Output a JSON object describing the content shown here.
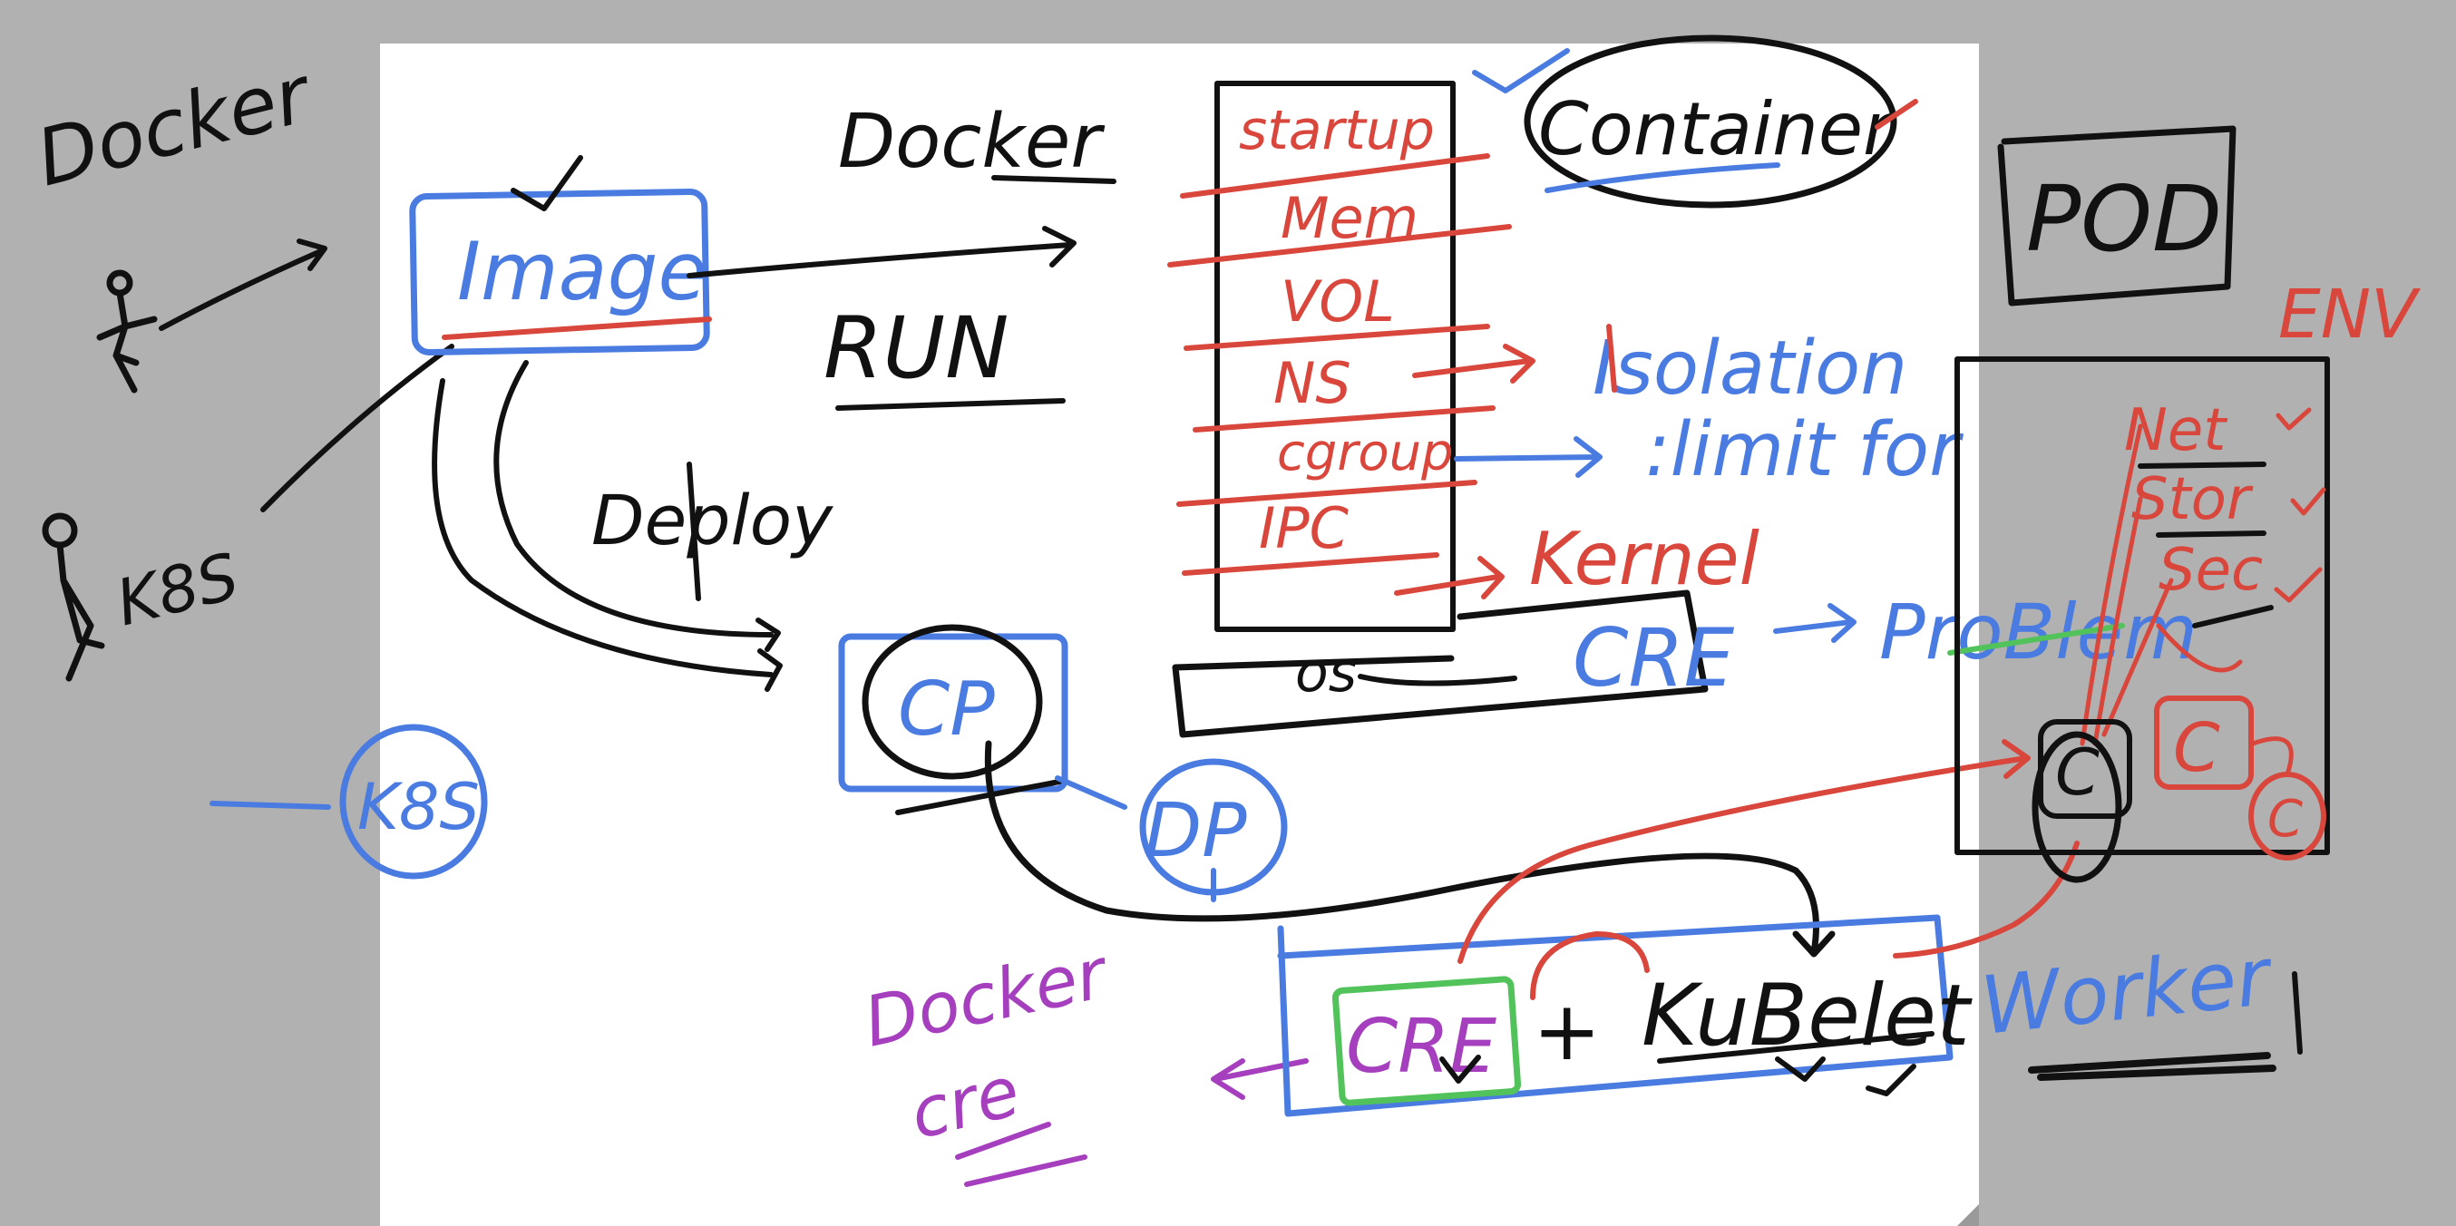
{
  "colors": {
    "background": "#b1b1b1",
    "board": "#ffffff",
    "ink_black": "#111111",
    "ink_blue": "#4a7be0",
    "ink_red": "#d8463c",
    "ink_purple": "#a53fbe",
    "ink_green": "#52c25a"
  },
  "labels": {
    "docker_top_left": "Docker",
    "k8s_actor": "K8S",
    "image": "Image",
    "docker_title": "Docker",
    "run": "RUN",
    "deploy": "Deploy",
    "container_stack": [
      "startup",
      "Mem",
      "VOL",
      "NS",
      "cgroup",
      "IPC"
    ],
    "container": "Container",
    "isolation": "Isolation",
    "limit": ":limit for",
    "kernel": "Kernel",
    "cre_1": "CRE",
    "problem": "ProBlem",
    "os_bar": "os",
    "cp": "CP",
    "dp": "DP",
    "k8s_circle": "K8S",
    "docker_cre_1": "Docker",
    "docker_cre_2": "cre",
    "cre_2": "CRE",
    "plus": "+",
    "kubelet": "KuBelet",
    "pod": "POD",
    "env": "ENV",
    "net": "Net",
    "stor": "Stor",
    "sec": "Sec",
    "container_c1": "C",
    "container_c2": "C",
    "container_c3": "C",
    "worker": "Worker"
  }
}
